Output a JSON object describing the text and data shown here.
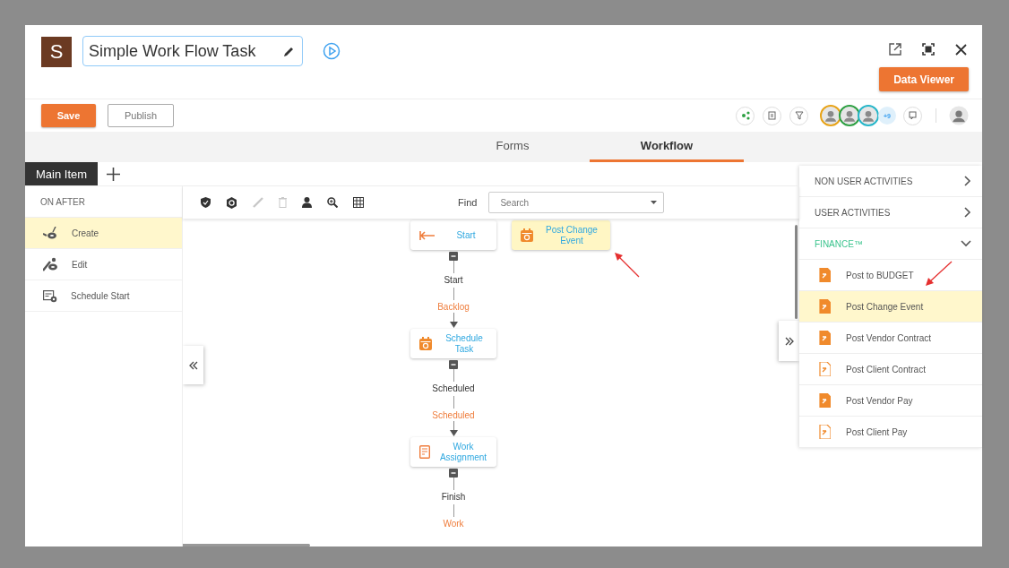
{
  "header": {
    "badge": "S",
    "title": "Simple Work Flow Task",
    "data_viewer": "Data Viewer"
  },
  "actions": {
    "save": "Save",
    "publish": "Publish",
    "collaborators": [
      {
        "color": "#e8a317"
      },
      {
        "color": "#2ea043"
      },
      {
        "color": "#26b6c9"
      }
    ],
    "more": "+9"
  },
  "tabs": [
    {
      "label": "Forms",
      "selected": false
    },
    {
      "label": "Workflow",
      "selected": true
    }
  ],
  "item_tabs": [
    {
      "label": "Main Item",
      "selected": true
    }
  ],
  "triggers": {
    "heading": "ON AFTER",
    "items": [
      {
        "kind": "create",
        "label": "Create",
        "selected": true
      },
      {
        "kind": "edit",
        "label": "Edit",
        "selected": false
      },
      {
        "kind": "schedule",
        "label": "Schedule Start",
        "selected": false
      }
    ]
  },
  "tools": [
    {
      "kind": "shield",
      "disabled": false
    },
    {
      "kind": "badge",
      "disabled": false
    },
    {
      "kind": "pencil",
      "disabled": true
    },
    {
      "kind": "trash",
      "disabled": true
    },
    {
      "kind": "person",
      "disabled": false
    },
    {
      "kind": "zoom",
      "disabled": false
    },
    {
      "kind": "grid",
      "disabled": false
    }
  ],
  "find": {
    "label": "Find",
    "placeholder": "Search"
  },
  "flow": [
    {
      "kind": "start",
      "label": "Start",
      "exit": "Start",
      "entry": "Backlog"
    },
    {
      "kind": "calendar",
      "label": "Schedule Task",
      "exit": "Scheduled",
      "entry": "Scheduled"
    },
    {
      "kind": "assignment",
      "label": "Work Assignment",
      "exit": "Finish",
      "entry": "Work"
    }
  ],
  "dropped_node": {
    "kind": "calendar",
    "label": "Post Change Event",
    "highlighted": true
  },
  "palette": [
    {
      "label": "NON USER ACTIVITIES",
      "expanded": false
    },
    {
      "label": "USER ACTIVITIES",
      "expanded": false
    },
    {
      "label": "FINANCE™",
      "expanded": true,
      "items": [
        {
          "label": "Post to BUDGET",
          "selected": false
        },
        {
          "label": "Post Change Event",
          "selected": true
        },
        {
          "label": "Post Vendor Contract",
          "selected": false
        },
        {
          "label": "Post Client Contract",
          "selected": false
        },
        {
          "label": "Post Vendor Pay",
          "selected": false
        },
        {
          "label": "Post Client Pay",
          "selected": false
        }
      ]
    }
  ]
}
